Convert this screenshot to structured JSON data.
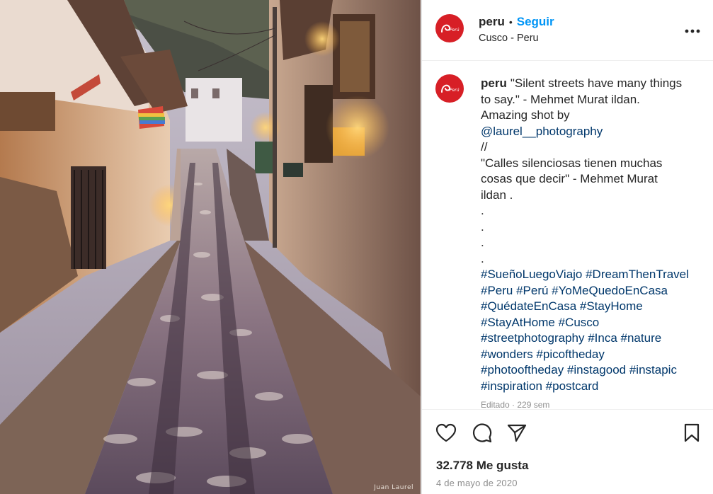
{
  "photo": {
    "credit": "Juan Laurel"
  },
  "post": {
    "author": "peru",
    "separator": "•",
    "follow_label": "Seguir",
    "location": "Cusco - Peru",
    "more_icon": "more-horizontal-icon"
  },
  "caption": {
    "author": "peru",
    "lines": [
      "\"Silent streets have many things",
      "to say.\" - Mehmet Murat ildan.",
      "Amazing shot by"
    ],
    "mention": "@laurel__photography",
    "lines2": [
      "//",
      "\"Calles silenciosas tienen muchas",
      "cosas que decir\" - Mehmet Murat",
      "ildan .",
      ".",
      ".",
      ".",
      "."
    ],
    "hashtag_lines": [
      "#SueñoLuegoViajo #DreamThenTravel",
      "#Peru #Perú #YoMeQuedoEnCasa",
      "#QuédateEnCasa #StayHome",
      "#StayAtHome #Cusco",
      "#streetphotography #Inca #nature",
      "#wonders #picoftheday",
      "#photooftheday #instagood #instapic",
      "#inspiration #postcard"
    ],
    "edited": "Editado · 229 sem"
  },
  "actions": {
    "like_icon": "heart-icon",
    "comment_icon": "comment-icon",
    "share_icon": "paper-plane-icon",
    "save_icon": "bookmark-icon",
    "likes_text": "32.778 Me gusta",
    "date_text": "4 de mayo de 2020"
  },
  "colors": {
    "follow": "#0095f6",
    "brand_red": "#d71f26",
    "link": "#00376b",
    "muted": "#8e8e8e"
  }
}
